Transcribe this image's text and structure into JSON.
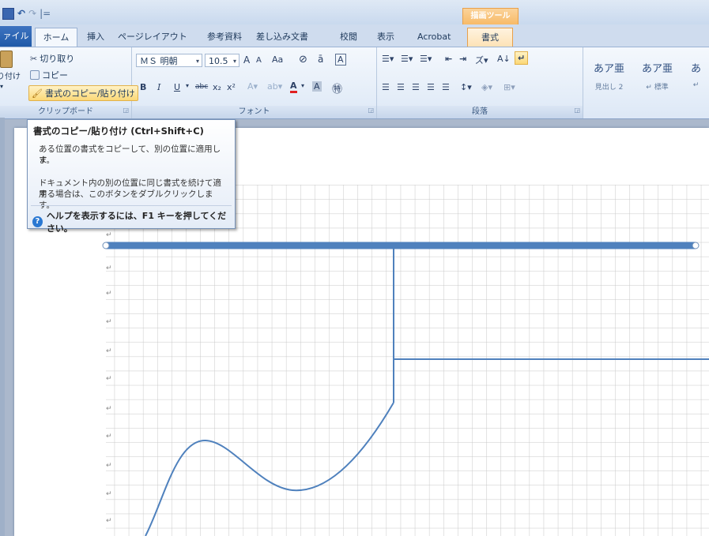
{
  "qat": {
    "save_icon": "save-icon",
    "undo": "↶",
    "redo": "↷",
    "more": "|="
  },
  "contextual": {
    "drawing_tools": "描画ツール"
  },
  "tabs": {
    "file": "ァイル",
    "home": "ホーム",
    "insert": "挿入",
    "page_layout": "ページレイアウト",
    "references": "参考資料",
    "mailings": "差し込み文書",
    "review": "校閲",
    "view": "表示",
    "acrobat": "Acrobat",
    "format": "書式"
  },
  "clipboard": {
    "paste": "り付け",
    "cut": "切り取り",
    "copy": "コピー",
    "format_painter": "書式のコピー/貼り付け",
    "group": "クリップボード"
  },
  "font": {
    "name": "ＭＳ 明朝",
    "size": "10.5",
    "grow": "A",
    "shrink": "A",
    "case": "Aa",
    "group": "フォント"
  },
  "paragraph": {
    "group": "段落"
  },
  "styles": {
    "items": [
      {
        "preview": "あア亜",
        "label": "見出し 2"
      },
      {
        "preview": "あア亜",
        "label": "↵ 標準"
      },
      {
        "preview": "あ",
        "label": "↵"
      }
    ]
  },
  "tooltip": {
    "title": "書式のコピー/貼り付け (Ctrl+Shift+C)",
    "desc1": "ある位置の書式をコピーして、別の位置に適用しま",
    "desc1b": "す。",
    "desc2": "ドキュメント内の別の位置に同じ書式を続けて適用",
    "desc2b": "する場合は、このボタンをダブルクリックします。",
    "help": "ヘルプを表示するには、F1 キーを押してください。"
  },
  "colors": {
    "accent": "#4f81bd",
    "line_thick": "#4f81bd",
    "grid": "#c8c8c8"
  }
}
